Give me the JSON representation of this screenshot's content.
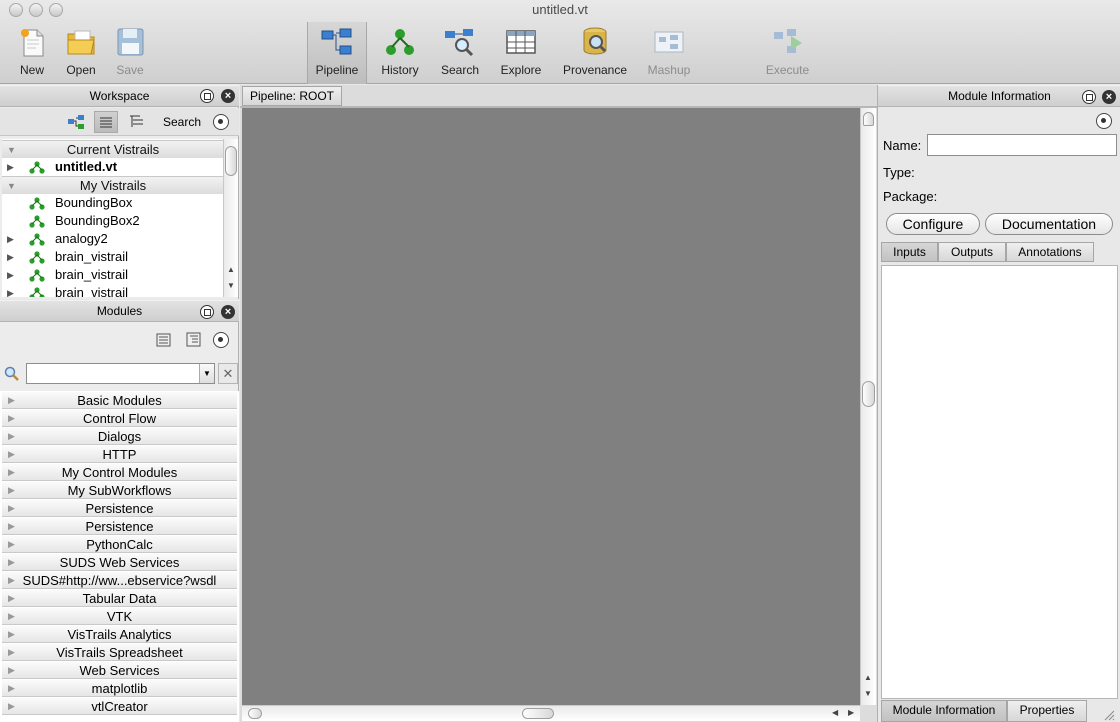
{
  "window": {
    "title": "untitled.vt"
  },
  "toolbar": {
    "left": [
      {
        "label": "New",
        "icon": "new-document-icon",
        "enabled": true
      },
      {
        "label": "Open",
        "icon": "open-folder-icon",
        "enabled": true
      },
      {
        "label": "Save",
        "icon": "save-floppy-icon",
        "enabled": false
      }
    ],
    "center": [
      {
        "label": "Pipeline",
        "icon": "pipeline-icon",
        "active": true
      },
      {
        "label": "History",
        "icon": "history-tree-icon"
      },
      {
        "label": "Search",
        "icon": "search-magnifier-icon"
      },
      {
        "label": "Explore",
        "icon": "explore-grid-icon"
      },
      {
        "label": "Provenance",
        "icon": "provenance-database-icon"
      },
      {
        "label": "Mashup",
        "icon": "mashup-icon",
        "enabled": false
      },
      {
        "label": "Execute",
        "icon": "execute-icon",
        "enabled": false
      }
    ]
  },
  "workspace": {
    "title": "Workspace",
    "search_label": "Search",
    "groups": [
      {
        "label": "Current Vistrails",
        "items": [
          {
            "label": "untitled.vt",
            "bold": true,
            "expandable": true
          }
        ]
      },
      {
        "label": "My Vistrails",
        "items": [
          {
            "label": "BoundingBox",
            "expandable": false
          },
          {
            "label": "BoundingBox2",
            "expandable": false
          },
          {
            "label": "analogy2",
            "expandable": true
          },
          {
            "label": "brain_vistrail",
            "expandable": true
          },
          {
            "label": "brain_vistrail",
            "expandable": true
          },
          {
            "label": "brain_vistrail",
            "expandable": true
          }
        ]
      }
    ]
  },
  "modules": {
    "title": "Modules",
    "search_value": "",
    "packages": [
      "Basic Modules",
      "Control Flow",
      "Dialogs",
      "HTTP",
      "My Control Modules",
      "My SubWorkflows",
      "Persistence",
      "Persistence",
      "PythonCalc",
      "SUDS Web Services",
      "SUDS#http://ww...ebservice?wsdl",
      "Tabular Data",
      "VTK",
      "VisTrails Analytics",
      "VisTrails Spreadsheet",
      "Web Services",
      "matplotlib",
      "vtlCreator"
    ]
  },
  "pipeline": {
    "tab_label": "Pipeline: ROOT",
    "canvas_color": "#808080"
  },
  "module_info": {
    "title": "Module Information",
    "name_label": "Name:",
    "name_value": "",
    "type_label": "Type:",
    "package_label": "Package:",
    "configure_label": "Configure",
    "documentation_label": "Documentation",
    "tabs": [
      "Inputs",
      "Outputs",
      "Annotations"
    ],
    "bottom_tabs": [
      "Module Information",
      "Properties"
    ]
  },
  "colors": {
    "vistrail_icon": "#2a9d2a",
    "pipeline_icon": "#3a7fd0"
  }
}
